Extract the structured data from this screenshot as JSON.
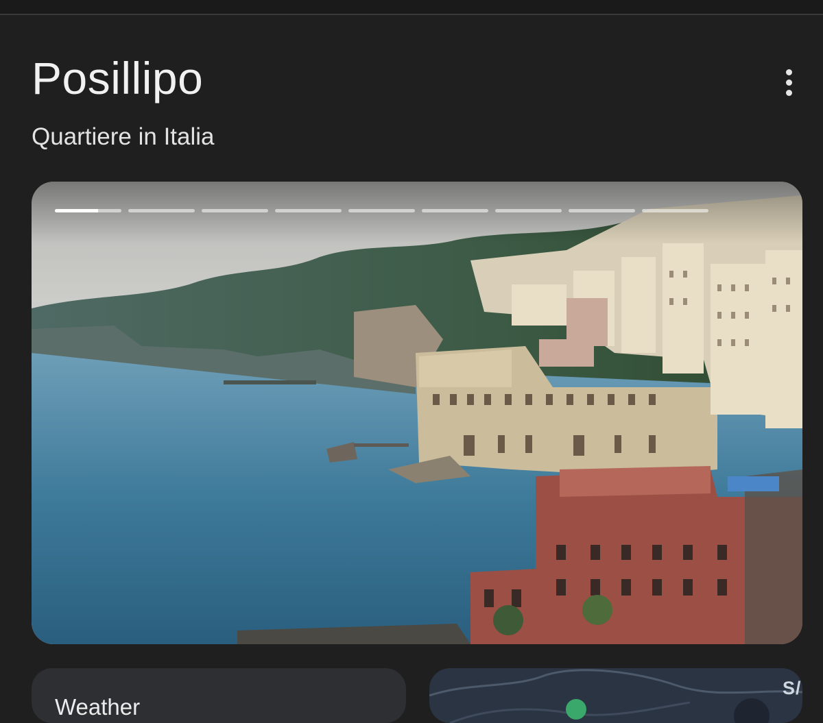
{
  "header": {
    "title": "Posillipo",
    "subtitle": "Quartiere in Italia",
    "more_icon": "more-vert-icon"
  },
  "hero_image": {
    "description_icon": "photo-posillipo",
    "slide_count": 9,
    "current_slide": 1,
    "current_slide_progress": 0.65
  },
  "cards": {
    "weather": {
      "label": "Weather"
    },
    "map": {
      "label": "S/"
    }
  },
  "colors": {
    "background": "#1f1f1f",
    "text": "#f1f1f1",
    "card": "#2e2f33"
  }
}
